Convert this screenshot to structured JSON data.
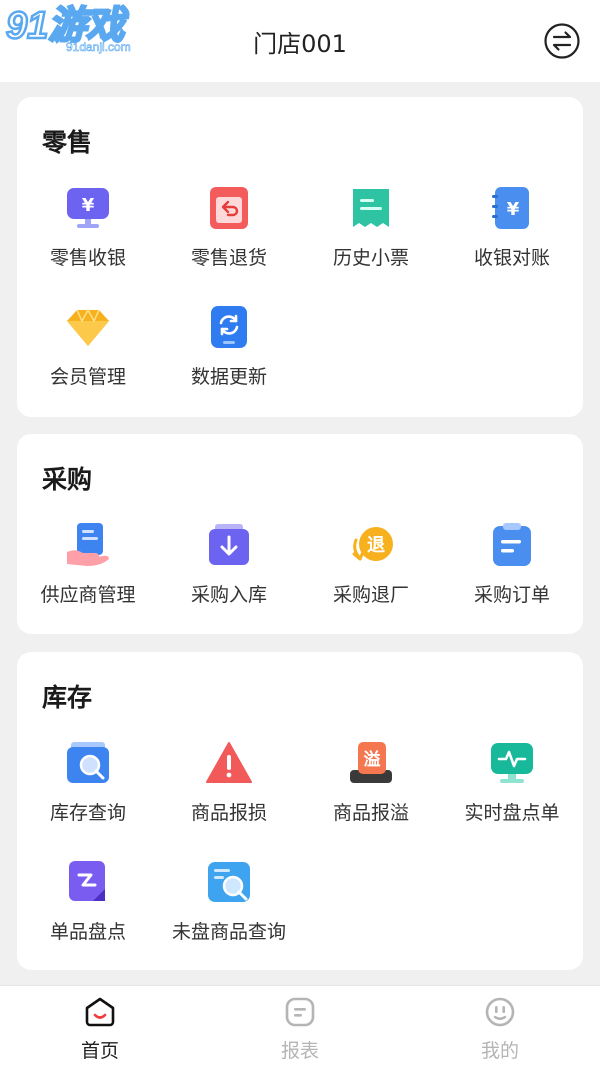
{
  "watermark": {
    "logo_text": "91游戏",
    "logo_url_text": "91danji.com"
  },
  "header": {
    "title": "门店001"
  },
  "sections": [
    {
      "title": "零售",
      "items": [
        {
          "label": "零售收银",
          "icon": "cashier-monitor-icon"
        },
        {
          "label": "零售退货",
          "icon": "return-receipt-icon"
        },
        {
          "label": "历史小票",
          "icon": "history-receipt-icon"
        },
        {
          "label": "收银对账",
          "icon": "reconcile-notebook-icon"
        },
        {
          "label": "会员管理",
          "icon": "diamond-icon"
        },
        {
          "label": "数据更新",
          "icon": "refresh-phone-icon"
        }
      ]
    },
    {
      "title": "采购",
      "items": [
        {
          "label": "供应商管理",
          "icon": "supplier-hand-icon"
        },
        {
          "label": "采购入库",
          "icon": "inbound-box-icon"
        },
        {
          "label": "采购退厂",
          "icon": "purchase-return-icon",
          "badge": "退"
        },
        {
          "label": "采购订单",
          "icon": "order-clipboard-icon"
        }
      ]
    },
    {
      "title": "库存",
      "items": [
        {
          "label": "库存查询",
          "icon": "stock-search-icon"
        },
        {
          "label": "商品报损",
          "icon": "warning-icon"
        },
        {
          "label": "商品报溢",
          "icon": "overflow-icon",
          "badge": "溢"
        },
        {
          "label": "实时盘点单",
          "icon": "pulse-monitor-icon"
        },
        {
          "label": "单品盘点",
          "icon": "edit-note-icon"
        },
        {
          "label": "未盘商品查询",
          "icon": "uncounted-search-icon"
        }
      ]
    }
  ],
  "tabbar": [
    {
      "label": "首页",
      "icon": "home-face-icon",
      "active": true
    },
    {
      "label": "报表",
      "icon": "report-icon",
      "active": false
    },
    {
      "label": "我的",
      "icon": "profile-face-icon",
      "active": false
    }
  ],
  "colors": {
    "primary_blue": "#4a8ff0",
    "red": "#f25a5a",
    "teal": "#2ec4a3",
    "orange": "#f7b11e",
    "purple": "#7b5cf0",
    "background": "#f0f0f0"
  }
}
